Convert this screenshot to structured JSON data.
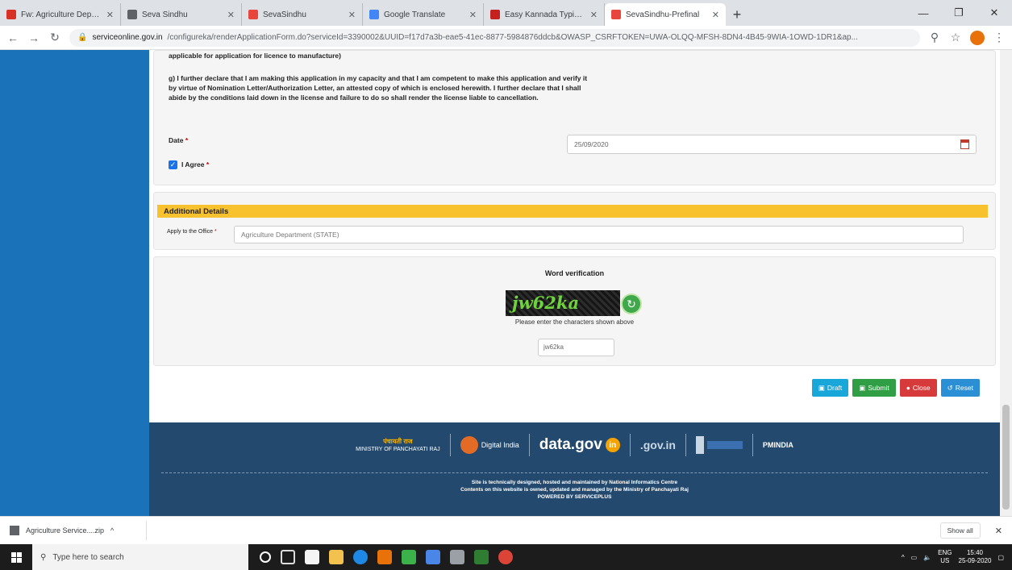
{
  "browser": {
    "tabs": [
      {
        "title": "Fw: Agriculture Department | ",
        "color": "#d93025"
      },
      {
        "title": "Seva Sindhu",
        "color": "#5f6368"
      },
      {
        "title": "SevaSindhu",
        "color": "#e8453c"
      },
      {
        "title": "Google Translate",
        "color": "#4285f4"
      },
      {
        "title": "Easy Kannada Typing - English",
        "color": "#c5221f"
      },
      {
        "title": "SevaSindhu-Prefinal",
        "color": "#e8453c"
      }
    ],
    "address": {
      "host": "serviceonline.gov.in",
      "path": "/configureka/renderApplicationForm.do?serviceId=3390002&UUID=f17d7a3b-eae5-41ec-8877-5984876ddcb&OWASP_CSRFTOKEN=UWA-OLQQ-MFSH-8DN4-4B45-9WIA-1OWD-1DR1&ap..."
    }
  },
  "form": {
    "declaration_top": "applicable for application for licence to manufacture)",
    "declaration_g": "g) I further declare that I am making this application in my capacity and that I am competent to make this application and verify it by virtue of Nomination Letter/Authorization Letter, an attested copy of which is enclosed herewith. I further declare that I shall abide by the conditions laid down in the license and failure to do so shall render the license liable to cancellation.",
    "date_label": "Date",
    "date_value": "25/09/2020",
    "agree_label": "I Agree",
    "additional_header": "Additional Details",
    "office_label": "Apply to the Office",
    "office_value": "Agriculture Department (STATE)",
    "captcha_title": "Word verification",
    "captcha_text": "jw62ka",
    "captcha_help": "Please enter the characters shown above",
    "captcha_input": "jw62ka",
    "buttons": {
      "draft": "Draft",
      "submit": "Submit",
      "close": "Close",
      "reset": "Reset"
    }
  },
  "footer": {
    "ministry": "MINISTRY OF PANCHAYATI RAJ",
    "ministry_hindi": "पंचायती राज",
    "digital_india": "Digital India",
    "datagov": "data.gov",
    "datagov_in": "in",
    "india_gov": ".gov.in",
    "pmindia": "PMINDIA",
    "line1": "Site is technically designed, hosted and maintained by National Informatics Centre",
    "line2": "Contents on this website is owned, updated and managed by the Ministry of Panchayati Raj",
    "line3": "POWERED BY SERVICEPLUS"
  },
  "downloads": {
    "file": "Agriculture Service....zip",
    "show_all": "Show all"
  },
  "taskbar": {
    "search_placeholder": "Type here to search",
    "lang": "ENG",
    "lang_sub": "US",
    "time": "15:40",
    "date": "25-09-2020"
  }
}
